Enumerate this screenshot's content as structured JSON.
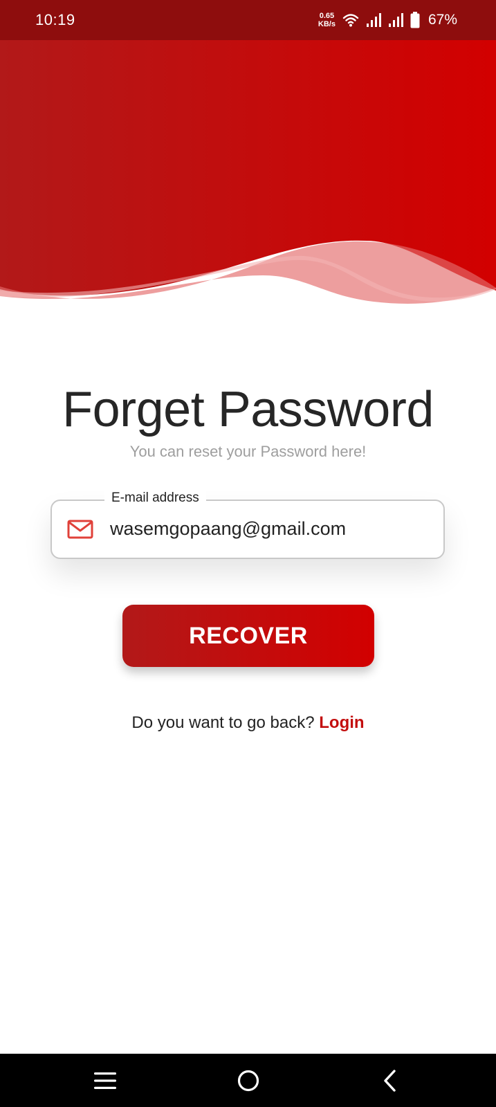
{
  "status_bar": {
    "time": "10:19",
    "net_speed_value": "0.65",
    "net_speed_unit": "KB/s",
    "battery": "67%"
  },
  "colors": {
    "accent": "#c30e0e",
    "header_start": "#b21919",
    "header_end": "#d20000",
    "status_bar": "#8e0d0d"
  },
  "main": {
    "title": "Forget Password",
    "subtitle": "You can reset your Password here!",
    "email_field": {
      "label": "E-mail address",
      "value": "wasemgopaang@gmail.com",
      "icon": "mail-icon"
    },
    "recover_button": "RECOVER",
    "back_prompt": "Do you want to go back?",
    "login_link": "Login"
  },
  "nav_bar": {
    "icons": [
      "menu-icon",
      "home-icon",
      "back-icon"
    ]
  }
}
